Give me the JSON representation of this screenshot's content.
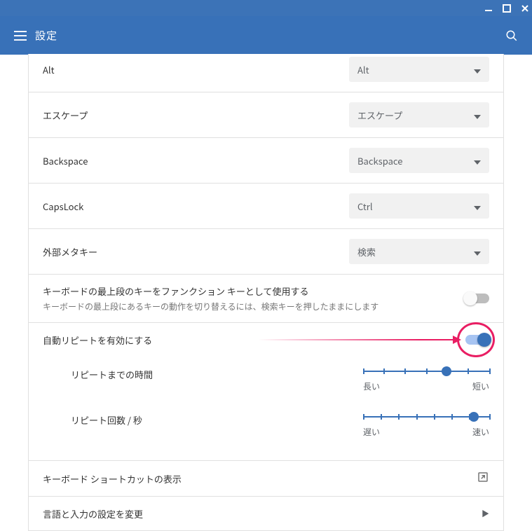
{
  "window": {
    "minimize": "−",
    "maximize": "□",
    "close": "×"
  },
  "header": {
    "title": "設定"
  },
  "keyRows": [
    {
      "label": "Alt",
      "value": "Alt",
      "partialTop": true
    },
    {
      "label": "エスケープ",
      "value": "エスケープ"
    },
    {
      "label": "Backspace",
      "value": "Backspace"
    },
    {
      "label": "CapsLock",
      "value": "Ctrl"
    },
    {
      "label": "外部メタキー",
      "value": "検索"
    }
  ],
  "functionKeys": {
    "title": "キーボードの最上段のキーをファンクション キーとして使用する",
    "subtitle": "キーボードの最上段にあるキーの動作を切り替えるには、検索キーを押したままにします",
    "enabled": false
  },
  "autoRepeat": {
    "title": "自動リピートを有効にする",
    "enabled": true,
    "highlighted": true,
    "delay": {
      "label": "リピートまでの時間",
      "leftLabel": "長い",
      "rightLabel": "短い",
      "positionPct": 66
    },
    "rate": {
      "label": "リピート回数 / 秒",
      "leftLabel": "遅い",
      "rightLabel": "速い",
      "positionPct": 88
    }
  },
  "shortcutLink": {
    "label": "キーボード ショートカットの表示"
  },
  "langInputLink": {
    "label": "言語と入力の設定を変更"
  }
}
